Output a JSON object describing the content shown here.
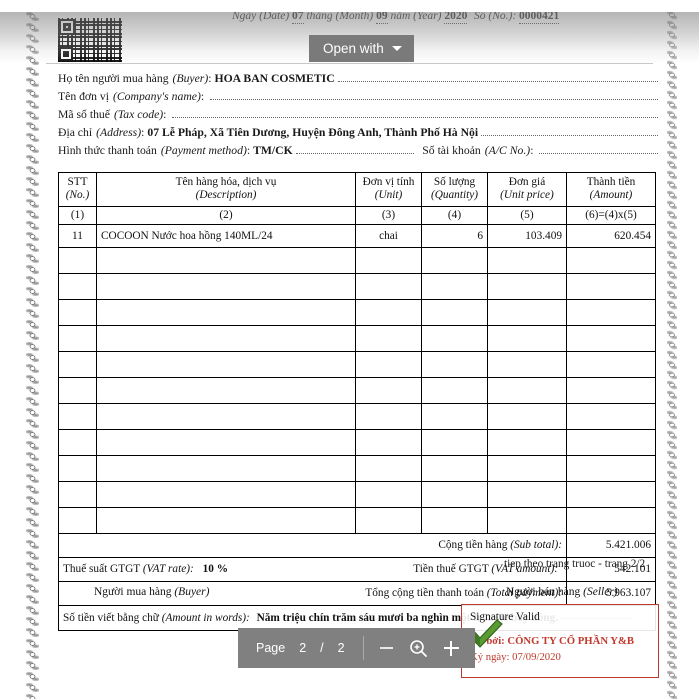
{
  "viewer": {
    "open_with_label": "Open with",
    "open_with_icon": "chevron-down-icon"
  },
  "document": {
    "date_line": {
      "prefix": "Ngày (Date)",
      "day": "07",
      "month_label": "tháng (Month)",
      "month": "09",
      "year_label": "năm (Year)",
      "year": "2020",
      "no_label": "Số (No.):",
      "no_value": "0000421"
    },
    "info_lines": [
      {
        "label": "Họ tên người mua hàng",
        "label_en": "(Buyer)",
        "value": "HOA BAN COSMETIC"
      },
      {
        "label": "Tên đơn vị",
        "label_en": "(Company's name)",
        "value": ""
      },
      {
        "label": "Mã số thuế",
        "label_en": "(Tax code)",
        "value": ""
      },
      {
        "label": "Địa chỉ",
        "label_en": "(Address)",
        "value": "07 Lễ Pháp, Xã Tiên Dương, Huyện Đông Anh, Thành Phố Hà Nội"
      },
      {
        "label": "Hình thức thanh toán",
        "label_en": "(Payment method)",
        "value": "TM/CK"
      }
    ],
    "account_label": "Số tài khoản",
    "account_label_en": "(A/C No.)",
    "account_value": "",
    "table": {
      "headers": [
        {
          "vi": "STT",
          "en": "(No.)"
        },
        {
          "vi": "Tên hàng hóa, dịch vụ",
          "en": "(Description)"
        },
        {
          "vi": "Đơn vị tính",
          "en": "(Unit)"
        },
        {
          "vi": "Số lượng",
          "en": "(Quantity)"
        },
        {
          "vi": "Đơn giá",
          "en": "(Unit price)"
        },
        {
          "vi": "Thành tiền",
          "en": "(Amount)"
        }
      ],
      "numbers_row": [
        "(1)",
        "(2)",
        "(3)",
        "(4)",
        "(5)",
        "(6)=(4)x(5)"
      ],
      "rows": [
        {
          "stt": "11",
          "desc": "COCOON Nước hoa hồng 140ML/24",
          "unit": "chai",
          "qty": "6",
          "price": "103.409",
          "amount": "620.454"
        }
      ],
      "empty_row_count": 11,
      "subtotal_label": "Cộng tiền hàng",
      "subtotal_label_en": "(Sub total):",
      "subtotal_value": "5.421.006",
      "vat_rate_label": "Thuế suất GTGT",
      "vat_rate_label_en": "(VAT rate):",
      "vat_rate_value": "10 %",
      "vat_amount_label": "Tiền thuế GTGT",
      "vat_amount_label_en": "(VAT amount):",
      "vat_amount_value": "542.101",
      "total_label": "Tổng cộng tiền thanh toán",
      "total_label_en": "(Total payment):",
      "total_value": "5.963.107",
      "words_label": "Số tiền viết bằng chữ",
      "words_label_en": "(Amount in words):",
      "words_value": "Năm triệu chín trăm sáu mươi ba nghìn một trăm lẻ bảy đồng."
    },
    "footer": {
      "continuation": "tiep theo trang truoc - trang 2/2",
      "buyer_label": "Người mua hàng",
      "buyer_label_en": "(Buyer)",
      "seller_label": "Người bán hàng",
      "seller_label_en": "(Seller)"
    },
    "signature": {
      "valid_text": "Signature Valid",
      "signed_by": "Ký bởi: CÔNG TY CỔ PHẦN Y&B",
      "signed_date": "Ký ngày: 07/09/2020",
      "border_color": "#c0392b",
      "text_color": "#c0392b",
      "check_color": "#4f8a2e"
    }
  },
  "toolbar": {
    "page_label": "Page",
    "current_page": "2",
    "separator": "/",
    "total_pages": "2",
    "zoom_out_icon": "minus-icon",
    "zoom_icon": "magnifier-plus-icon",
    "zoom_in_icon": "plus-icon"
  }
}
